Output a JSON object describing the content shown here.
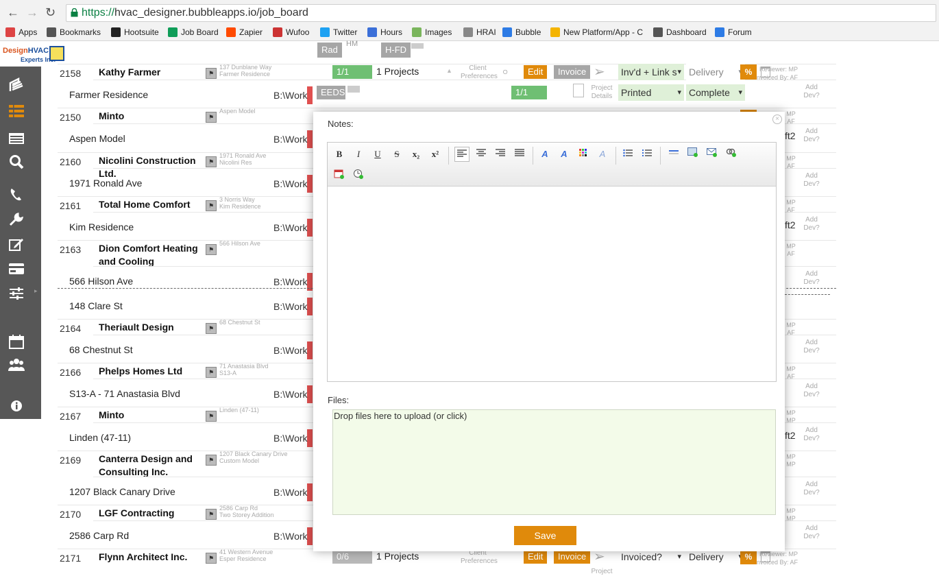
{
  "browser": {
    "url_scheme": "https://",
    "url_rest": "hvac_designer.bubbleapps.io/job_board",
    "bookmarks": [
      {
        "label": "Apps",
        "icon": "apps-grid-icon",
        "color": "#d44"
      },
      {
        "label": "Bookmarks",
        "icon": "star-icon",
        "color": "#555"
      },
      {
        "label": "Hootsuite",
        "icon": "hootsuite-icon",
        "color": "#222"
      },
      {
        "label": "Job Board",
        "icon": "sheet-icon",
        "color": "#0f9d58"
      },
      {
        "label": "Zapier",
        "icon": "zapier-icon",
        "color": "#ff4a00"
      },
      {
        "label": "Wufoo",
        "icon": "wufoo-icon",
        "color": "#c33"
      },
      {
        "label": "Twitter",
        "icon": "twitter-icon",
        "color": "#1da1f2"
      },
      {
        "label": "Hours",
        "icon": "calendar-icon",
        "color": "#3b6fd8"
      },
      {
        "label": "Images",
        "icon": "shopify-icon",
        "color": "#7ab55c"
      },
      {
        "label": "HRAI",
        "icon": "page-icon",
        "color": "#888"
      },
      {
        "label": "Bubble",
        "icon": "bubble-icon",
        "color": "#2d7be5"
      },
      {
        "label": "New Platform/App - C",
        "icon": "drive-icon",
        "color": "#f4b400"
      },
      {
        "label": "Dashboard",
        "icon": "dashboard-icon",
        "color": "#555"
      },
      {
        "label": "Forum",
        "icon": "bubble-icon",
        "color": "#2d7be5"
      }
    ]
  },
  "logo": {
    "line1a": "Design",
    "line1b": "HVAC",
    "line2": "Experts Inc."
  },
  "header_pills": {
    "rad": "Rad",
    "hm": "HM",
    "hfd": "H-FD"
  },
  "jobs": [
    {
      "num": "2158",
      "client": "Kathy Farmer",
      "addr1": "137 Dunblane Way",
      "addr2": "Farmer Residence",
      "projects": [
        {
          "name": "Farmer Residence",
          "bwork": "B:\\Work"
        }
      ]
    },
    {
      "num": "2150",
      "client": "Minto",
      "addr1": "Aspen Model",
      "addr2": "",
      "projects": [
        {
          "name": "Aspen Model",
          "bwork": "B:\\Work"
        }
      ]
    },
    {
      "num": "2160",
      "client": "Nicolini Construction Ltd.",
      "addr1": "1971 Ronald Ave",
      "addr2": "Nicolini Res",
      "projects": [
        {
          "name": "1971 Ronald Ave",
          "bwork": "B:\\Work"
        }
      ]
    },
    {
      "num": "2161",
      "client": "Total Home Comfort",
      "addr1": "3 Norris Way",
      "addr2": "Kim Residence",
      "projects": [
        {
          "name": "Kim Residence",
          "bwork": "B:\\Work"
        }
      ]
    },
    {
      "num": "2163",
      "client": "Dion Comfort Heating and Cooling",
      "addr1": "566 Hilson Ave",
      "addr2": "",
      "projects": [
        {
          "name": "566 Hilson Ave",
          "bwork": "B:\\Work"
        },
        {
          "name": "148 Clare St",
          "bwork": "B:\\Work"
        }
      ]
    },
    {
      "num": "2164",
      "client": "Theriault Design",
      "addr1": "68 Chestnut St",
      "addr2": "",
      "projects": [
        {
          "name": "68 Chestnut St",
          "bwork": "B:\\Work"
        }
      ]
    },
    {
      "num": "2166",
      "client": "Phelps Homes Ltd",
      "addr1": "71 Anastasia Blvd",
      "addr2": "S13-A",
      "projects": [
        {
          "name": "S13-A - 71 Anastasia Blvd",
          "bwork": "B:\\Work"
        }
      ]
    },
    {
      "num": "2167",
      "client": "Minto",
      "addr1": "Linden (47-11)",
      "addr2": "",
      "projects": [
        {
          "name": "Linden (47-11)",
          "bwork": "B:\\Work"
        }
      ]
    },
    {
      "num": "2169",
      "client": "Canterra Design and Consulting Inc.",
      "addr1": "1207 Black Canary Drive",
      "addr2": "Custom Model",
      "projects": [
        {
          "name": "1207 Black Canary Drive",
          "bwork": "B:\\Work"
        }
      ]
    },
    {
      "num": "2170",
      "client": "LGF Contracting",
      "addr1": "2586 Carp Rd",
      "addr2": "Two Storey Addition",
      "projects": [
        {
          "name": "2586 Carp Rd",
          "bwork": "B:\\Work"
        }
      ]
    },
    {
      "num": "2171",
      "client": "Flynn Architect Inc.",
      "addr1": "41 Western Avenue",
      "addr2": "Esper Residence",
      "projects": []
    }
  ],
  "row2158": {
    "progress": "1/1",
    "projects": "1 Projects",
    "client_pref": "Client Preferences",
    "edit": "Edit",
    "invoice": "Invoice",
    "inv_status": "Inv'd + Link s",
    "delivery": "Delivery",
    "reviewer": "Reviewer: MP",
    "invoiced_by": "Invoiced By: AF",
    "eeds": "EEDS",
    "progress2": "1/1",
    "project_details": "Project Details",
    "printed": "Printed",
    "complete": "Complete",
    "add_dev": "Add Dev?"
  },
  "row2171": {
    "progress": "0/6",
    "projects": "1 Projects",
    "client_pref": "Client Preferences",
    "edit": "Edit",
    "invoice": "Invoice",
    "inv_status": "Invoiced?",
    "delivery": "Delivery",
    "reviewer": "Reviewer: MP",
    "invoiced_by": "Invoiced By: AF",
    "project_details": "Project"
  },
  "right_col": {
    "pct": "%",
    "mp": "MP",
    "af": "AF",
    "add_dev": "Add Dev?",
    "ft2": "ft2"
  },
  "modal": {
    "notes_label": "Notes:",
    "files_label": "Files:",
    "dropzone_text": "Drop files here to upload (or click)",
    "save_label": "Save",
    "close_glyph": "×",
    "toolbar": {
      "bold": "B",
      "italic": "I",
      "underline": "U",
      "strike": "S",
      "sub": "x₂",
      "sup": "x²"
    }
  }
}
